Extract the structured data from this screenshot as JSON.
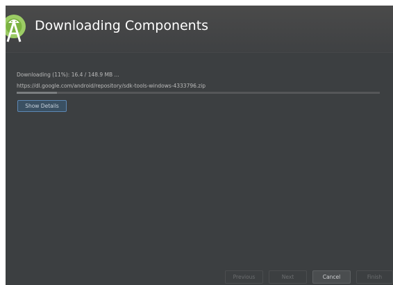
{
  "header": {
    "title": "Downloading Components"
  },
  "download": {
    "status": "Downloading (11%): 16.4 / 148.9 MB ...",
    "url": "https://dl.google.com/android/repository/sdk-tools-windows-4333796.zip",
    "progress_fraction": 0.11
  },
  "actions": {
    "show_details": "Show Details"
  },
  "footer": {
    "previous": "Previous",
    "next": "Next",
    "cancel": "Cancel",
    "finish": "Finish"
  },
  "colors": {
    "background": "#3c3f41",
    "accent": "#5d88b5",
    "logo_green": "#9ccc65"
  }
}
